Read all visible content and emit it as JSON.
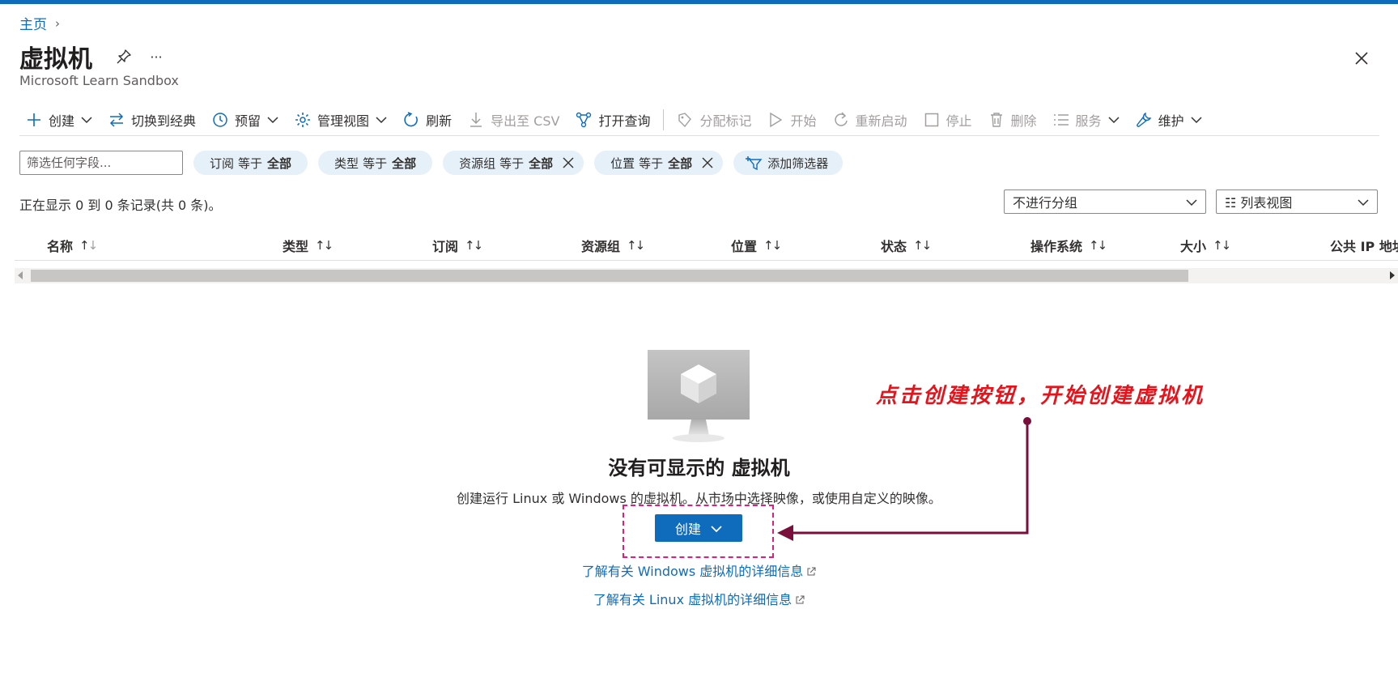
{
  "breadcrumb": {
    "home": "主页",
    "separator": "›"
  },
  "page": {
    "title": "虚拟机",
    "subtitle": "Microsoft Learn Sandbox",
    "more_label": "···"
  },
  "toolbar": {
    "create": "创建",
    "switch_classic": "切换到经典",
    "reservations": "预留",
    "manage_view": "管理视图",
    "refresh": "刷新",
    "export_csv": "导出至 CSV",
    "open_query": "打开查询",
    "assign_tags": "分配标记",
    "start": "开始",
    "restart": "重新启动",
    "stop": "停止",
    "delete": "删除",
    "services": "服务",
    "maintenance": "维护"
  },
  "filters": {
    "search_placeholder": "筛选任何字段...",
    "pills": [
      {
        "field": "订阅",
        "op": "等于",
        "value": "全部",
        "removable": false
      },
      {
        "field": "类型",
        "op": "等于",
        "value": "全部",
        "removable": false
      },
      {
        "field": "资源组",
        "op": "等于",
        "value": "全部",
        "removable": true
      },
      {
        "field": "位置",
        "op": "等于",
        "value": "全部",
        "removable": true
      }
    ],
    "add_filter": "添加筛选器"
  },
  "record_count": "正在显示 0 到 0 条记录(共 0 条)。",
  "grouping": {
    "selected": "不进行分组"
  },
  "view_mode": {
    "selected": "☷ 列表视图"
  },
  "columns": [
    "名称",
    "类型",
    "订阅",
    "资源组",
    "位置",
    "状态",
    "操作系统",
    "大小",
    "公共 IP 地址"
  ],
  "sort_glyph": {
    "up": "↑",
    "down": "↓"
  },
  "empty_state": {
    "title": "没有可显示的 虚拟机",
    "description": "创建运行 Linux 或 Windows 的虚拟机。从市场中选择映像，或使用自定义的映像。",
    "create_button": "创建",
    "learn_windows": "了解有关 Windows 虚拟机的详细信息",
    "learn_linux": "了解有关 Linux 虚拟机的详细信息"
  },
  "annotation": {
    "text": "点击创建按钮，开始创建虚拟机",
    "color": "#e5141c",
    "arrow_color": "#7a0f3c",
    "box_color": "#e01e7b"
  },
  "colors": {
    "accent": "#0f6cbd",
    "pill_bg": "#e6f0f8"
  }
}
